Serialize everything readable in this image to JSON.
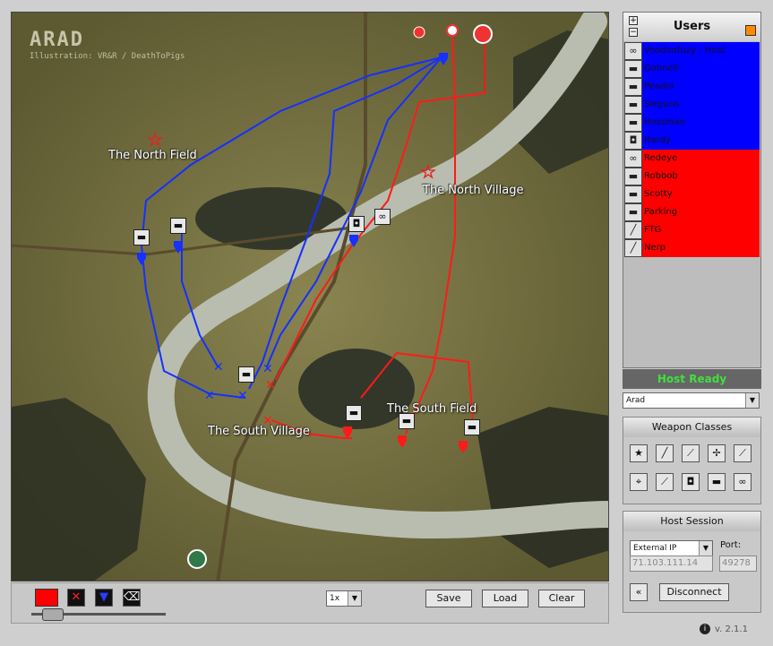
{
  "map": {
    "title": "ARAD",
    "credit": "Illustration: VR&R / DeathToPigs",
    "places": [
      "The North Field",
      "The North Village",
      "The South Field",
      "The South Village"
    ]
  },
  "toolbar": {
    "zoom": "1x",
    "save_label": "Save",
    "load_label": "Load",
    "clear_label": "Clear",
    "swatch_red": "#ff0000",
    "swatch_blue": "#0000ff"
  },
  "users": {
    "title": "Users",
    "expand": "+",
    "collapse": "−",
    "list": [
      {
        "name": "Voodoofuzy - Host",
        "team": "blue",
        "icon": "binoculars-icon"
      },
      {
        "name": "Gohnell",
        "team": "blue",
        "icon": "tank-icon"
      },
      {
        "name": "Peadol",
        "team": "blue",
        "icon": "tank-icon"
      },
      {
        "name": "Sieguns",
        "team": "blue",
        "icon": "tank-icon"
      },
      {
        "name": "Hossman",
        "team": "blue",
        "icon": "tank-icon"
      },
      {
        "name": "Hardy",
        "team": "blue",
        "icon": "armored-car-icon"
      },
      {
        "name": "Redeye",
        "team": "red",
        "icon": "binoculars-icon"
      },
      {
        "name": "Robbob",
        "team": "red",
        "icon": "tank-icon"
      },
      {
        "name": "Scotty",
        "team": "red",
        "icon": "tank-icon"
      },
      {
        "name": "Parking",
        "team": "red",
        "icon": "tank-icon"
      },
      {
        "name": "FTG",
        "team": "red",
        "icon": "rifle-icon"
      },
      {
        "name": "Nerp",
        "team": "red",
        "icon": "rifle-icon"
      }
    ],
    "team_colors": {
      "blue": "#0000ff",
      "red": "#ff0000"
    }
  },
  "status": {
    "host_ready": "Host Ready",
    "map_select": "Arad"
  },
  "weapon_classes": {
    "title": "Weapon Classes",
    "icons": [
      "star-icon",
      "knife-icon",
      "rifle-icon",
      "machine-gun-icon",
      "sniper-icon",
      "crosshair-icon",
      "pistol-icon",
      "armored-car-icon",
      "tank-icon",
      "binoculars-icon"
    ]
  },
  "host_session": {
    "title": "Host Session",
    "ip_type": "External IP",
    "ip": "71.103.111.14",
    "port_label": "Port:",
    "port": "49278",
    "back": "«",
    "disconnect": "Disconnect"
  },
  "version": "v. 2.1.1"
}
